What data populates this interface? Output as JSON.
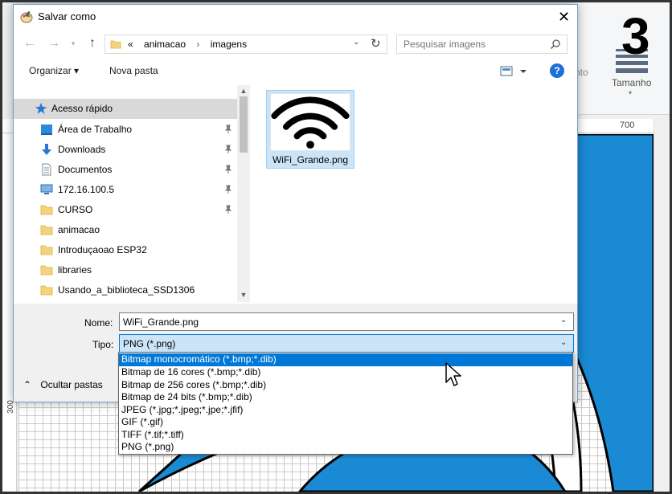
{
  "background_app": {
    "step_number": "3",
    "ribbon_text_left": "nto",
    "tamanho_label": "Tamanho",
    "ruler_top_label": "700",
    "ruler_left_label": "300",
    "canvas_color": "#1a8ad4"
  },
  "dialog": {
    "title": "Salvar como",
    "address": {
      "crumbs": [
        "«",
        "animacao",
        "›",
        "imagens"
      ]
    },
    "search": {
      "placeholder": "Pesquisar imagens"
    },
    "toolbar": {
      "organize_label": "Organizar ▾",
      "new_folder_label": "Nova pasta",
      "help_label": "?"
    },
    "nav_pane": {
      "items": [
        {
          "label": "Acesso rápido",
          "icon": "star-icon",
          "pinned": false
        },
        {
          "label": "Área de Trabalho",
          "icon": "desktop-icon",
          "pinned": true
        },
        {
          "label": "Downloads",
          "icon": "download-icon",
          "pinned": true
        },
        {
          "label": "Documentos",
          "icon": "document-icon",
          "pinned": true
        },
        {
          "label": "172.16.100.5",
          "icon": "network-computer-icon",
          "pinned": true
        },
        {
          "label": "CURSO",
          "icon": "folder-icon",
          "pinned": true
        },
        {
          "label": "animacao",
          "icon": "folder-icon",
          "pinned": false
        },
        {
          "label": "Introduçaoao ESP32",
          "icon": "folder-icon",
          "pinned": false
        },
        {
          "label": "libraries",
          "icon": "folder-icon",
          "pinned": false
        },
        {
          "label": "Usando_a_biblioteca_SSD1306",
          "icon": "folder-icon",
          "pinned": false
        }
      ]
    },
    "files": [
      {
        "name": "WiFi_Grande.png",
        "thumbnail": "wifi-icon"
      }
    ],
    "nome": {
      "label": "Nome:",
      "value": "WiFi_Grande.png"
    },
    "tipo": {
      "label": "Tipo:",
      "value": "PNG (*.png)",
      "options": [
        "Bitmap monocromático (*.bmp;*.dib)",
        "Bitmap de 16 cores (*.bmp;*.dib)",
        "Bitmap de 256 cores (*.bmp;*.dib)",
        "Bitmap de 24 bits (*.bmp;*.dib)",
        "JPEG (*.jpg;*.jpeg;*.jpe;*.jfif)",
        "GIF (*.gif)",
        "TIFF (*.tif;*.tiff)",
        "PNG (*.png)"
      ],
      "highlighted_index": 0
    },
    "hide_folders_label": "Ocultar pastas"
  }
}
